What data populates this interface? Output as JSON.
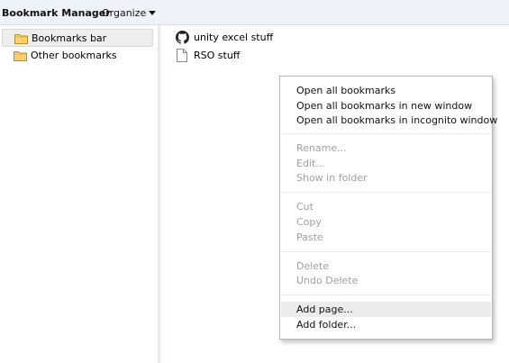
{
  "header": {
    "title": "Bookmark Manager",
    "organize_label": "Organize"
  },
  "sidebar": {
    "items": [
      {
        "label": "Bookmarks bar",
        "icon": "folder-icon",
        "selected": true
      },
      {
        "label": "Other bookmarks",
        "icon": "folder-icon",
        "selected": false
      }
    ]
  },
  "bookmarks": [
    {
      "label": "unity excel stuff",
      "icon": "github-icon"
    },
    {
      "label": "RSO stuff",
      "icon": "page-icon"
    }
  ],
  "context_menu": {
    "groups": [
      [
        {
          "label": "Open all bookmarks",
          "enabled": true
        },
        {
          "label": "Open all bookmarks in new window",
          "enabled": true
        },
        {
          "label": "Open all bookmarks in incognito window",
          "enabled": true
        }
      ],
      [
        {
          "label": "Rename...",
          "enabled": false
        },
        {
          "label": "Edit...",
          "enabled": false
        },
        {
          "label": "Show in folder",
          "enabled": false
        }
      ],
      [
        {
          "label": "Cut",
          "enabled": false
        },
        {
          "label": "Copy",
          "enabled": false
        },
        {
          "label": "Paste",
          "enabled": false
        }
      ],
      [
        {
          "label": "Delete",
          "enabled": false
        },
        {
          "label": "Undo Delete",
          "enabled": false
        }
      ],
      [
        {
          "label": "Add page...",
          "enabled": true,
          "hovered": true
        },
        {
          "label": "Add folder...",
          "enabled": true
        }
      ]
    ]
  },
  "colors": {
    "header_bg": "#eef2f9",
    "folder_fill": "#f5d06b",
    "disabled_text": "#a0a0a0",
    "menu_hover": "#ececec"
  }
}
